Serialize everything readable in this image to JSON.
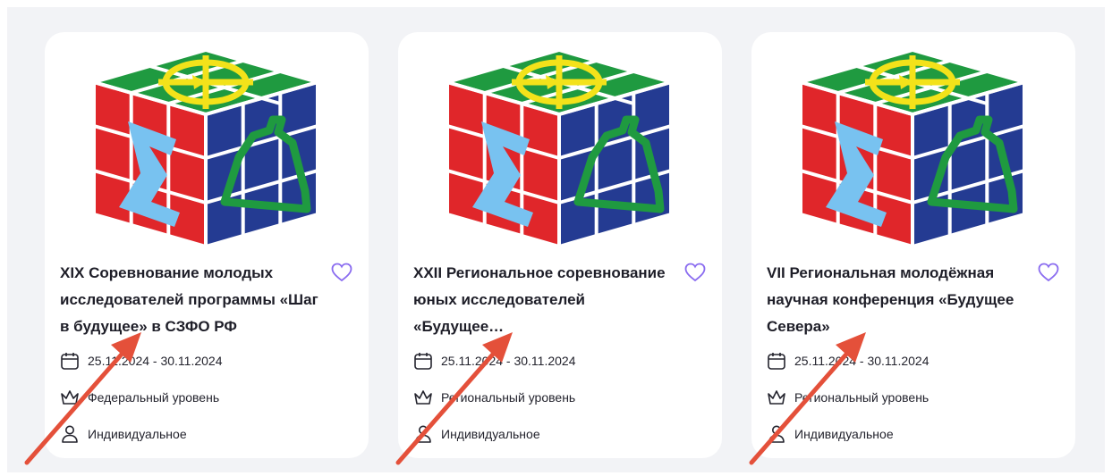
{
  "cards": [
    {
      "title": "XIX Соревнование молодых исследователей программы «Шаг в будущее» в СЗФО РФ",
      "date": "25.11.2024 - 30.11.2024",
      "level": "Федеральный уровень",
      "kind": "Индивидуальное"
    },
    {
      "title": "XXII Региональное соревнование юных исследователей «Будущее…",
      "date": "25.11.2024 - 30.11.2024",
      "level": "Региональный уровень",
      "kind": "Индивидуальное"
    },
    {
      "title": "VII Региональная молодёжная научная конференция «Будущее Севера»",
      "date": "25.11.2024 - 30.11.2024",
      "level": "Региональный уровень",
      "kind": "Индивидуальное"
    }
  ],
  "icons": {
    "favorite": "heart-icon",
    "date": "calendar-icon",
    "level": "crown-icon",
    "kind": "person-icon",
    "logo": "rubik-cube-logo"
  },
  "colors": {
    "accent": "#8a6cf0",
    "annotation_arrow": "#e4503a",
    "cube_red": "#e0262a",
    "cube_blue": "#243b92",
    "cube_green": "#1f9a40",
    "cube_yellow": "#f3e21a",
    "cube_lightblue": "#78c2f0"
  }
}
